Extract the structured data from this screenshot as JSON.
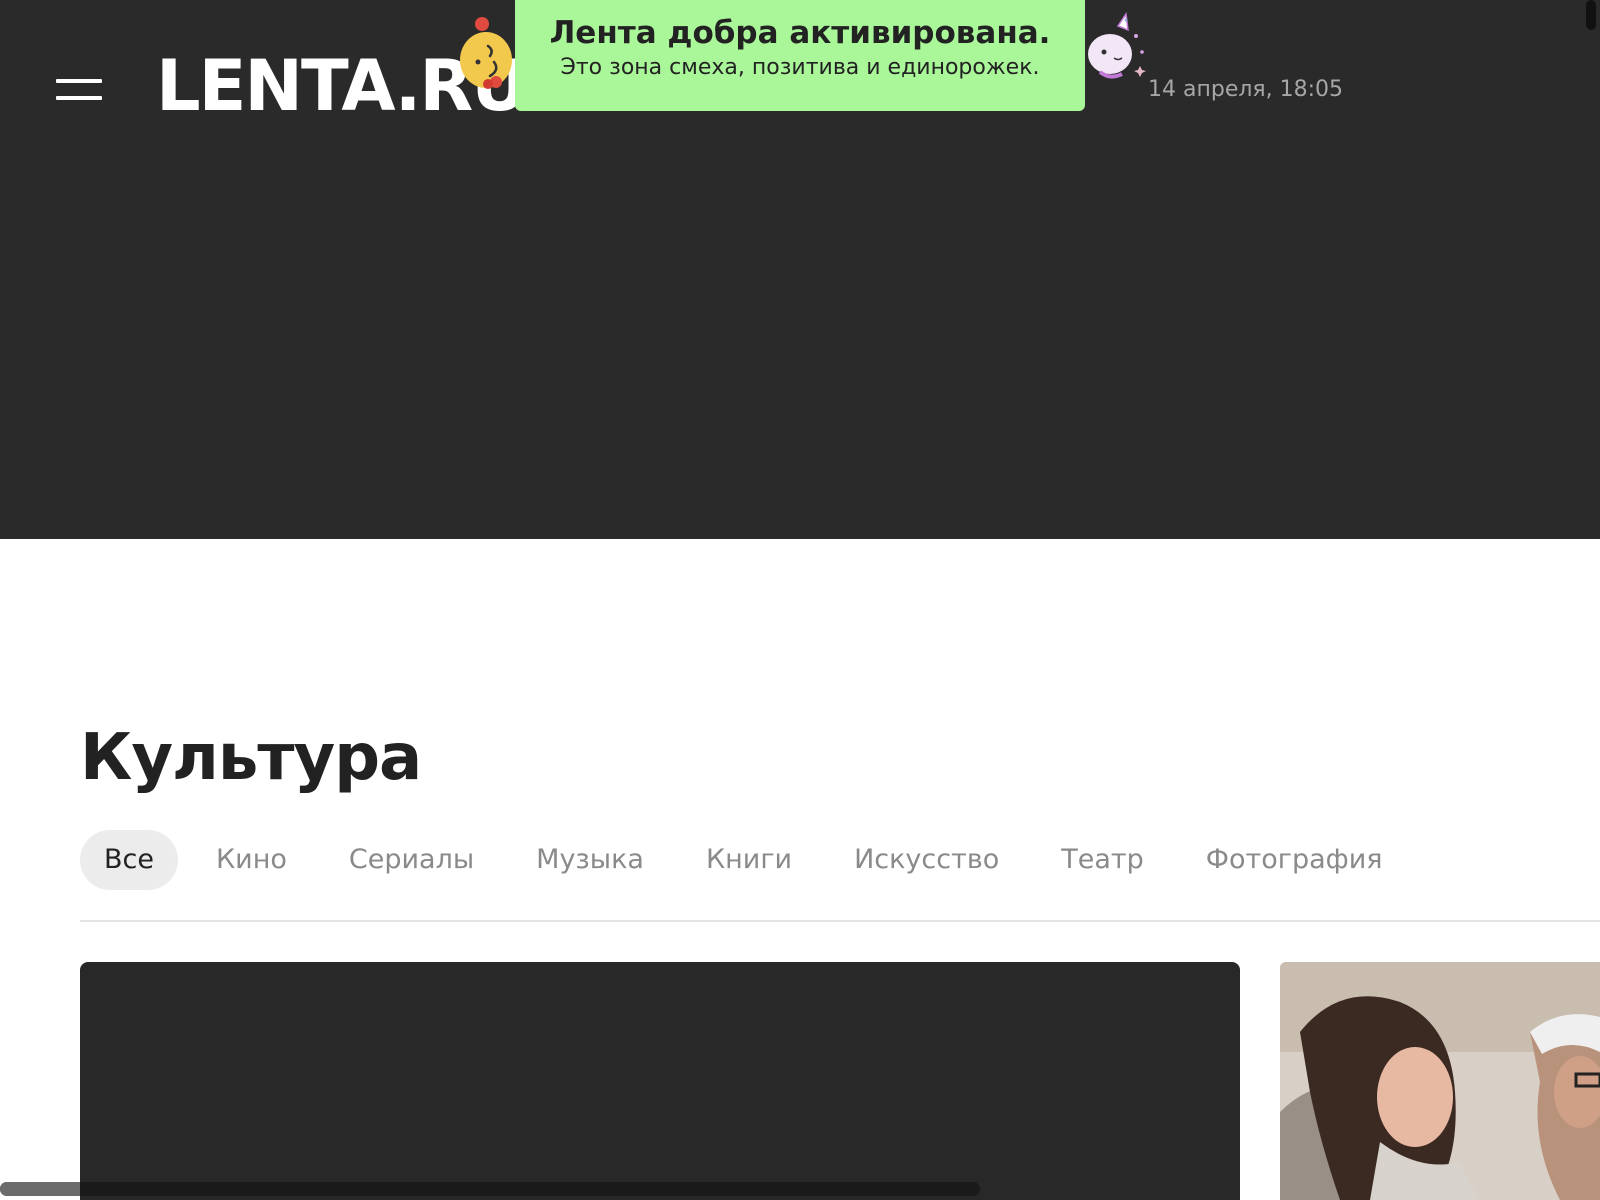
{
  "header": {
    "logo_text": "LENTA.RU",
    "datetime": "14 апреля, 18:05",
    "menu_icon": "hamburger-menu-icon"
  },
  "toast": {
    "title": "Лента добра активирована.",
    "subtitle": "Это зона смеха, позитива и единорожек.",
    "background_color": "#aaf79a"
  },
  "section": {
    "title": "Культура",
    "tabs": [
      {
        "label": "Все",
        "active": true
      },
      {
        "label": "Кино",
        "active": false
      },
      {
        "label": "Сериалы",
        "active": false
      },
      {
        "label": "Музыка",
        "active": false
      },
      {
        "label": "Книги",
        "active": false
      },
      {
        "label": "Искусство",
        "active": false
      },
      {
        "label": "Театр",
        "active": false
      },
      {
        "label": "Фотография",
        "active": false
      }
    ]
  },
  "colors": {
    "header_bg": "#2a2a2b",
    "text_dark": "#222222",
    "text_muted": "#8a8a8a",
    "tab_active_bg": "#ececec"
  },
  "icons": {
    "left_mascot": "smiling-emoji-icon",
    "right_mascot": "unicorn-icon"
  }
}
